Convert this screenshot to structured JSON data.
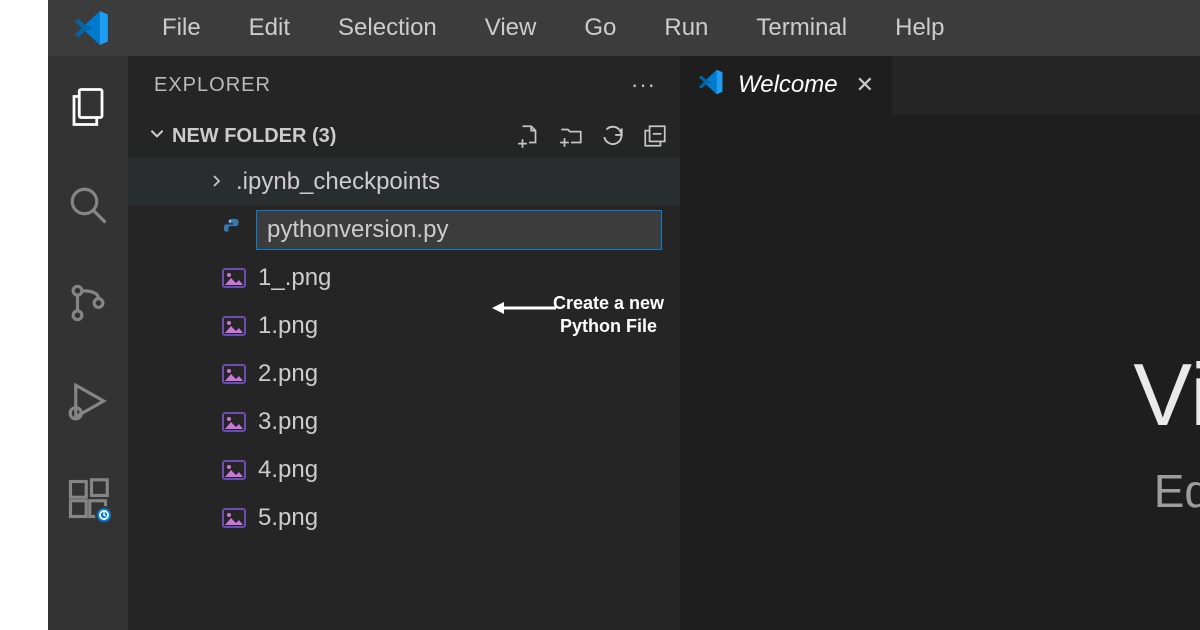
{
  "menubar": {
    "items": [
      "File",
      "Edit",
      "Selection",
      "View",
      "Go",
      "Run",
      "Terminal",
      "Help"
    ]
  },
  "sidebar": {
    "title": "EXPLORER",
    "folder_label": "NEW FOLDER (3)",
    "tree": {
      "folder1": ".ipynb_checkpoints",
      "new_file_value": "pythonversion.py",
      "files": [
        "1_.png",
        "1.png",
        "2.png",
        "3.png",
        "4.png",
        "5.png"
      ]
    }
  },
  "tabs": {
    "welcome": "Welcome"
  },
  "welcome": {
    "title_fragment": "Vi",
    "subtitle_fragment": "Ed"
  },
  "annotation": {
    "line1": "Create a new",
    "line2": "Python File"
  }
}
